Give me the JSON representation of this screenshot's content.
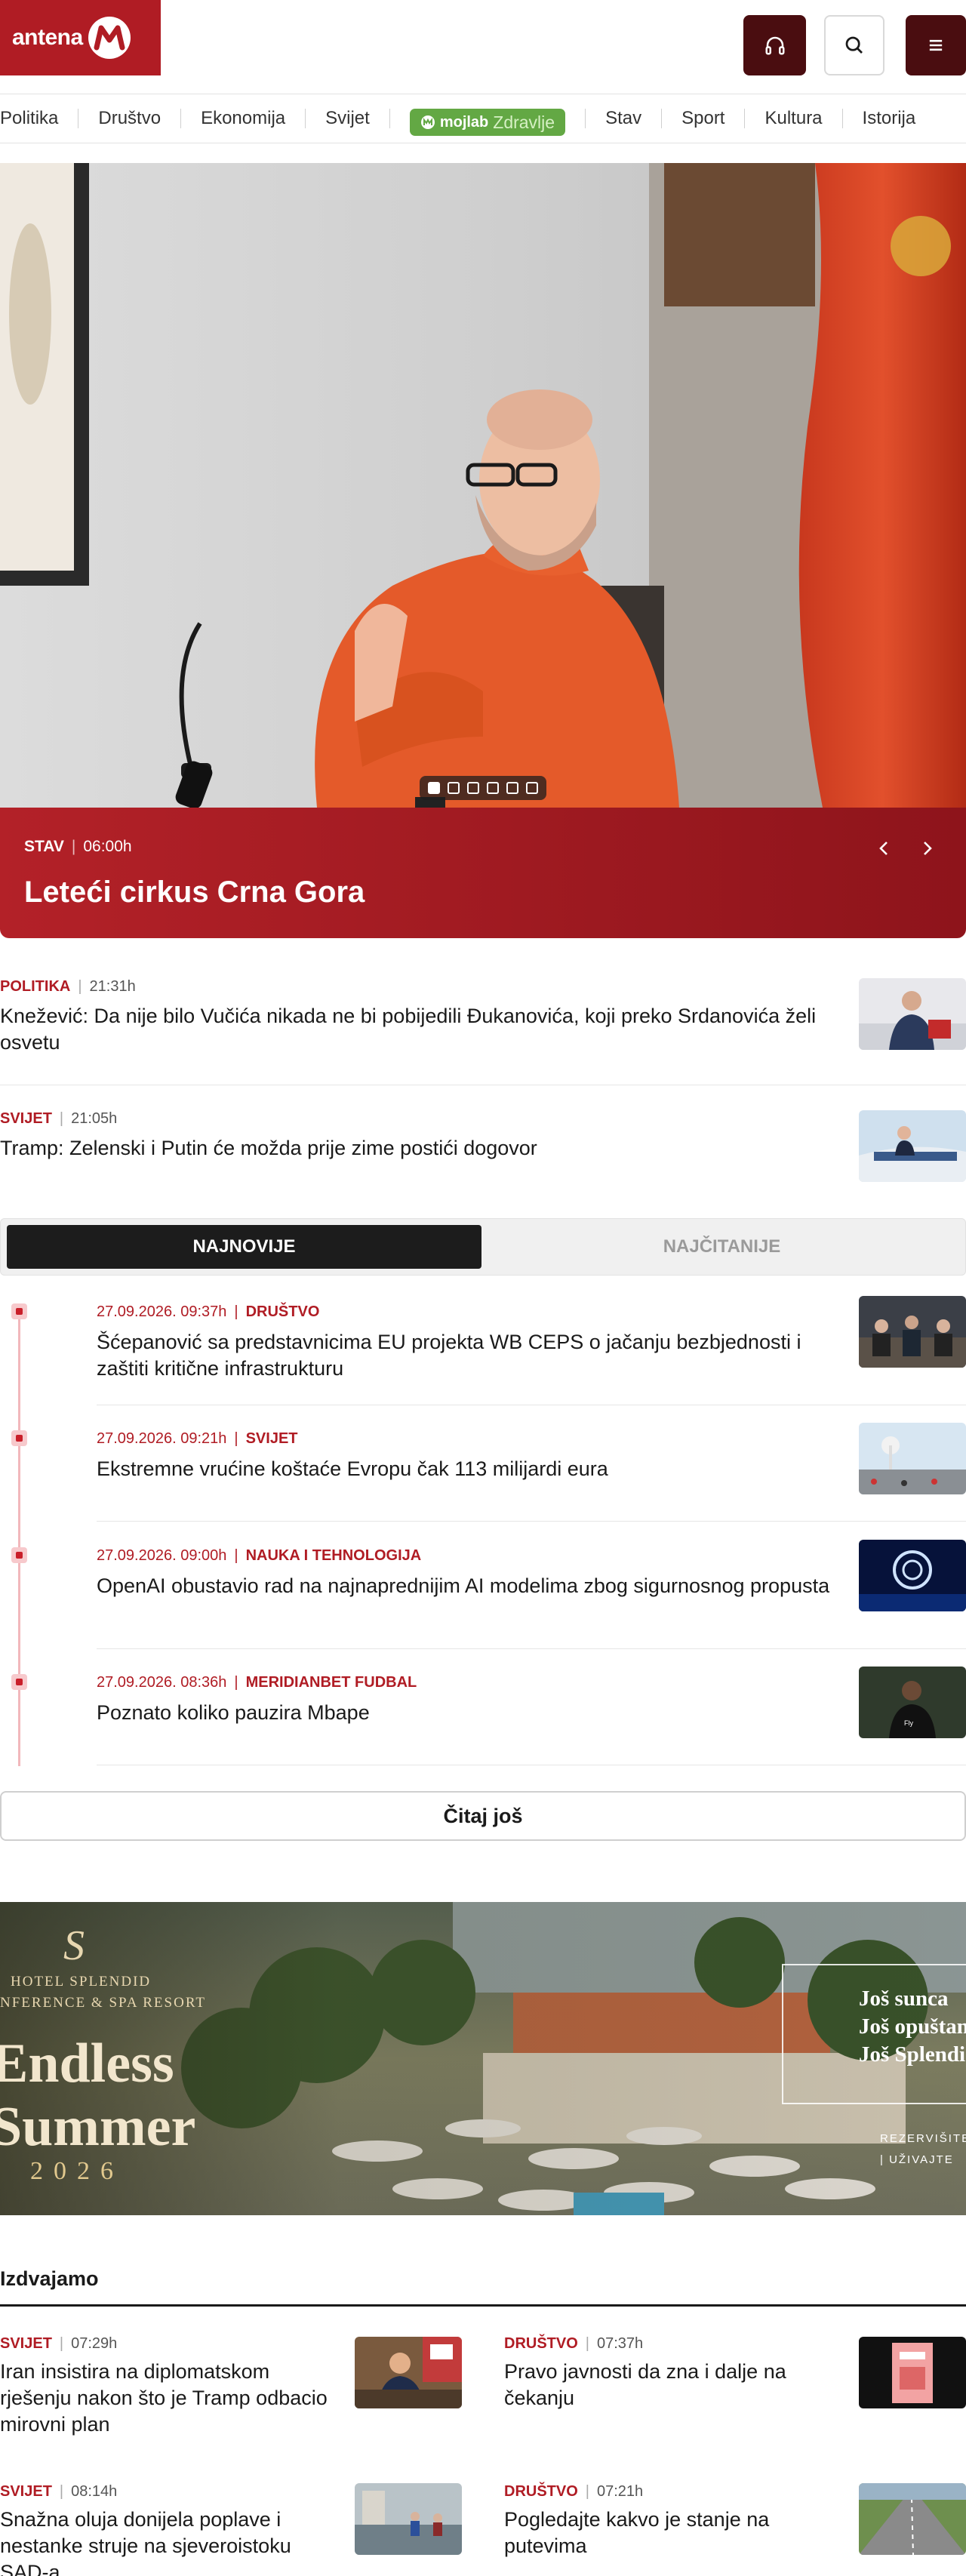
{
  "header": {
    "logo_text": "antena",
    "logo_letter": "M",
    "buttons": [
      "headphones-icon",
      "search-icon",
      "hamburger-menu-icon"
    ]
  },
  "nav": {
    "items": [
      "Politika",
      "Društvo",
      "Ekonomija",
      "Svijet"
    ],
    "special": {
      "brand": "mojlab",
      "label": "Zdravlje",
      "color": "#63a844"
    },
    "items_after": [
      "Stav",
      "Sport",
      "Kultura",
      "Istorija"
    ]
  },
  "hero": {
    "category": "STAV",
    "time": "06:00h",
    "title": "Leteći cirkus Crna Gora",
    "slides_total": 6,
    "slide_active": 1,
    "accent": "#b32128"
  },
  "top_stories": [
    {
      "category": "POLITIKA",
      "time": "21:31h",
      "title": "Knežević: Da nije bilo Vučića nikada ne bi pobijedili Đukanovića, koji preko Srdanovića želi osvetu"
    },
    {
      "category": "SVIJET",
      "time": "21:05h",
      "title": "Tramp: Zelenski i Putin će možda prije zime postići dogovor"
    }
  ],
  "tabs": {
    "latest": "NAJNOVIJE",
    "most_read": "NAJČITANIJE",
    "active": "latest"
  },
  "timeline": [
    {
      "date": "27.09.2026. 09:37h",
      "category": "DRUŠTVO",
      "title": "Šćepanović sa predstavnicima EU projekta WB CEPS o jačanju bezbjednosti i zaštiti kritične infrastrukturu"
    },
    {
      "date": "27.09.2026. 09:21h",
      "category": "SVIJET",
      "title": "Ekstremne vrućine koštaće Evropu čak 113 milijardi eura"
    },
    {
      "date": "27.09.2026. 09:00h",
      "category": "NAUKA I TEHNOLOGIJA",
      "title": "OpenAI obustavio rad na najnaprednijim AI modelima zbog sigurnosnog propusta"
    },
    {
      "date": "27.09.2026. 08:36h",
      "category": "MERIDIANBET FUDBAL",
      "title": "Poznato koliko pauzira Mbape"
    }
  ],
  "more_button": "Čitaj još",
  "ad": {
    "script_letter": "S",
    "brand_lines": [
      "HOTEL SPLENDID",
      "NFERENCE & SPA RESORT"
    ],
    "title_lines": [
      "Endless",
      "Summer"
    ],
    "year": "2026",
    "box_lines": [
      "Još sunca",
      "Još opuštan",
      "Još Splendi"
    ],
    "small_lines": [
      "REZERVIŠITE",
      "| UŽIVAJTE"
    ]
  },
  "featured": {
    "heading": "Izdvajamo",
    "items": [
      {
        "category": "SVIJET",
        "time": "07:29h",
        "title": "Iran insistira na diplomatskom rješenju nakon što je Tramp odbacio mirovni plan"
      },
      {
        "category": "DRUŠTVO",
        "time": "07:37h",
        "title": "Pravo javnosti da zna i dalje na čekanju"
      },
      {
        "category": "SVIJET",
        "time": "08:14h",
        "title": "Snažna oluja donijela poplave i nestanke struje na sjeveroistoku SAD-a"
      },
      {
        "category": "DRUŠTVO",
        "time": "07:21h",
        "title": "Pogledajte kakvo je stanje na putevima"
      }
    ]
  }
}
